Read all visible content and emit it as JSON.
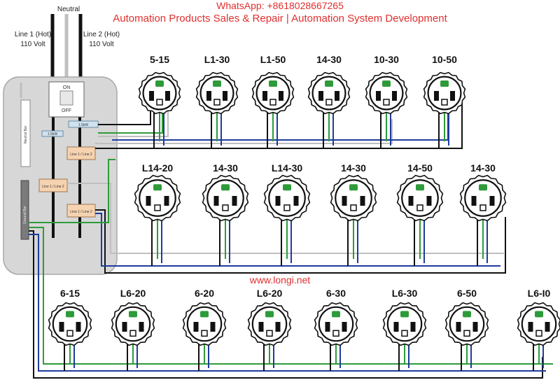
{
  "watermark": {
    "whatsapp": "WhatsApp: +8618028667265",
    "tagline": "Automation Products Sales & Repair | Automation System Development",
    "site": "www.longi.net"
  },
  "labels": {
    "neutral": "Neutral",
    "line1": "Line 1 (Hot)",
    "line1_volt": "110 Volt",
    "line2": "Line 2 (Hot)",
    "line2_volt": "110 Volt",
    "breaker_on": "ON",
    "breaker_off": "OFF",
    "neutral_bar": "Neutral Bar",
    "ground_bar": "Ground Bar"
  },
  "breakers": [
    "1.5kW",
    "1.5kW",
    "Line 1 / Line 2",
    "Line 1 / Line 2",
    "Line 1 / Line 2"
  ],
  "colors": {
    "hot": "#111111",
    "neutral": "#bfbfbf",
    "ground": "#2e9b3a",
    "return": "#1f3c9c",
    "panel": "#d7d7d7",
    "breaker": "#f6d3b0",
    "watermark": "#e0302f"
  },
  "rows": [
    [
      "5-15",
      "L1-30",
      "L1-50",
      "14-30",
      "10-30",
      "10-50"
    ],
    [
      "L14-20",
      "14-30",
      "L14-30",
      "14-30",
      "14-50",
      "14-30"
    ],
    [
      "6-15",
      "L6-20",
      "6-20",
      "L6-20",
      "6-30",
      "L6-30",
      "6-50",
      "L6-I0"
    ]
  ]
}
